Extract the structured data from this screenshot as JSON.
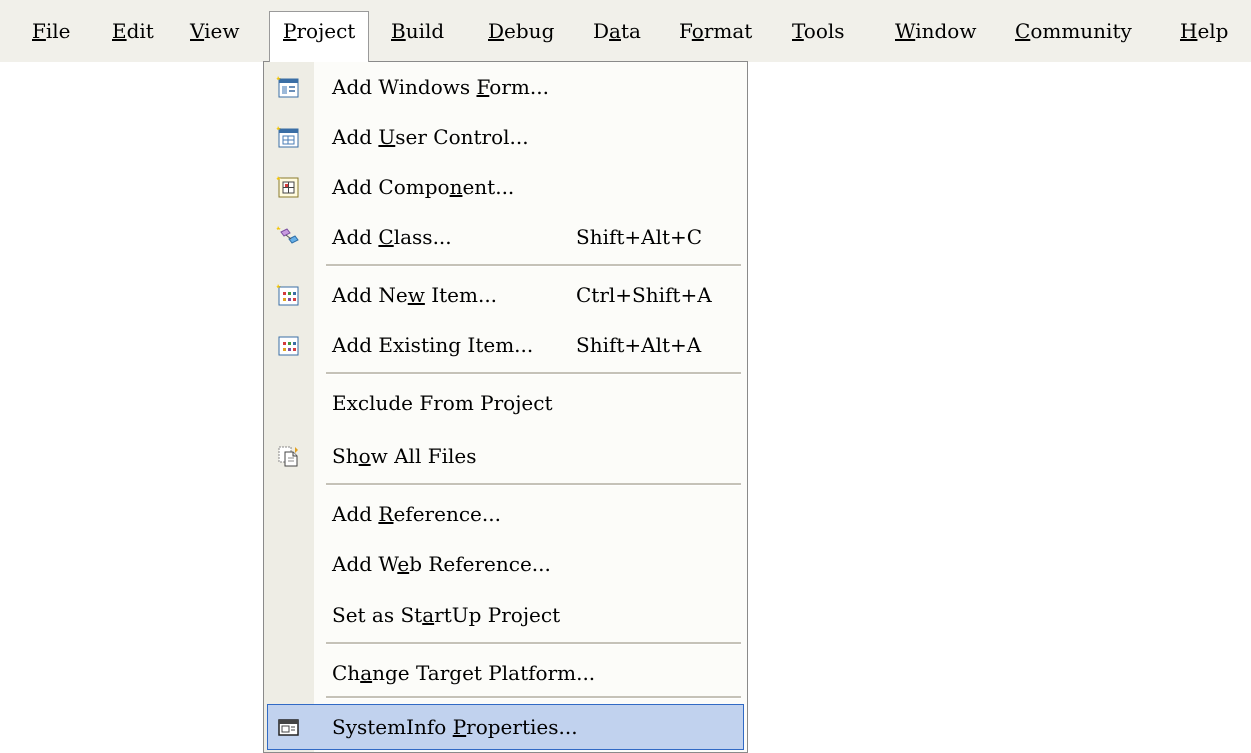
{
  "menubar": {
    "items": [
      {
        "pre": "",
        "ul": "F",
        "post": "ile"
      },
      {
        "pre": "",
        "ul": "E",
        "post": "dit"
      },
      {
        "pre": "",
        "ul": "V",
        "post": "iew"
      },
      {
        "pre": "",
        "ul": "P",
        "post": "roject"
      },
      {
        "pre": "",
        "ul": "B",
        "post": "uild"
      },
      {
        "pre": "",
        "ul": "D",
        "post": "ebug"
      },
      {
        "pre": "D",
        "ul": "a",
        "post": "ta"
      },
      {
        "pre": "F",
        "ul": "o",
        "post": "rmat"
      },
      {
        "pre": "",
        "ul": "T",
        "post": "ools"
      },
      {
        "pre": "",
        "ul": "W",
        "post": "indow"
      },
      {
        "pre": "",
        "ul": "C",
        "post": "ommunity"
      },
      {
        "pre": "",
        "ul": "H",
        "post": "elp"
      }
    ]
  },
  "project_menu": {
    "items": [
      {
        "pre": "Add Windows ",
        "ul": "F",
        "post": "orm...",
        "shortcut": "",
        "icon": "windows-form-icon"
      },
      {
        "pre": "Add ",
        "ul": "U",
        "post": "ser Control...",
        "shortcut": "",
        "icon": "user-control-icon"
      },
      {
        "pre": "Add Compo",
        "ul": "n",
        "post": "ent...",
        "shortcut": "",
        "icon": "component-icon"
      },
      {
        "pre": "Add ",
        "ul": "C",
        "post": "lass...",
        "shortcut": "Shift+Alt+C",
        "icon": "class-icon"
      },
      {
        "pre": "Add Ne",
        "ul": "w",
        "post": " Item...",
        "shortcut": "Ctrl+Shift+A",
        "icon": "new-item-icon"
      },
      {
        "pre": "Add Existing Item...",
        "ul": "",
        "post": "",
        "shortcut": "Shift+Alt+A",
        "icon": "existing-item-icon"
      },
      {
        "pre": "Exclude From Project",
        "ul": "",
        "post": "",
        "shortcut": "",
        "icon": ""
      },
      {
        "pre": "Sh",
        "ul": "o",
        "post": "w All Files",
        "shortcut": "",
        "icon": "show-all-files-icon"
      },
      {
        "pre": "Add ",
        "ul": "R",
        "post": "eference...",
        "shortcut": "",
        "icon": ""
      },
      {
        "pre": "Add W",
        "ul": "e",
        "post": "b Reference...",
        "shortcut": "",
        "icon": ""
      },
      {
        "pre": "Set as St",
        "ul": "a",
        "post": "rtUp Project",
        "shortcut": "",
        "icon": ""
      },
      {
        "pre": "Ch",
        "ul": "a",
        "post": "nge Target Platform...",
        "shortcut": "",
        "icon": ""
      },
      {
        "pre": "SystemInfo ",
        "ul": "P",
        "post": "roperties...",
        "shortcut": "",
        "icon": "properties-icon"
      }
    ]
  },
  "colors": {
    "menubar_bg": "#f1f0ea",
    "gutter_bg": "#eeede5",
    "highlight_bg": "#c1d2ee",
    "highlight_border": "#316ac5"
  }
}
